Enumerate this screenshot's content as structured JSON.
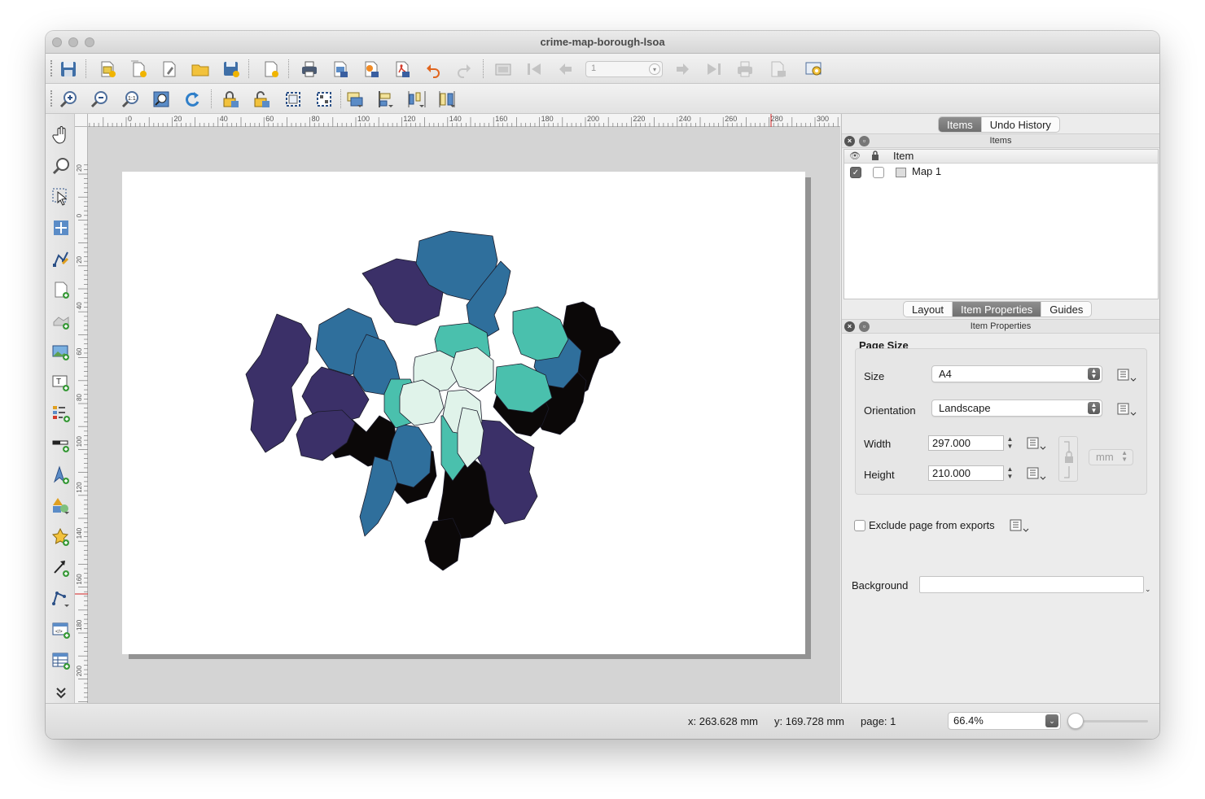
{
  "window": {
    "title": "crime-map-borough-lsoa"
  },
  "toolbar": {
    "page_number": "1",
    "icons_row1": [
      "save-icon",
      "new-layout-icon",
      "duplicate-layout-icon",
      "layout-manager-icon",
      "open-template-icon",
      "save-template-icon",
      "add-pages-icon",
      "print-icon",
      "export-image-icon",
      "export-svg-icon",
      "export-pdf-icon",
      "undo-icon",
      "redo-icon",
      "atlas-preview-icon",
      "first-feature-icon",
      "previous-feature-icon",
      "next-feature-icon",
      "last-feature-icon",
      "print-atlas-icon",
      "export-atlas-icon",
      "atlas-settings-icon"
    ],
    "icons_row2": [
      "zoom-in-icon",
      "zoom-out-icon",
      "zoom-100-icon",
      "zoom-full-icon",
      "refresh-icon",
      "lock-items-icon",
      "unlock-items-icon",
      "group-items-icon",
      "ungroup-items-icon",
      "raise-items-icon",
      "align-items-icon",
      "distribute-items-icon",
      "resize-items-icon"
    ]
  },
  "left_tools": [
    "pan-icon",
    "zoom-tool-icon",
    "select-move-icon",
    "move-content-icon",
    "edit-nodes-icon",
    "add-map-icon",
    "add-3d-map-icon",
    "add-picture-icon",
    "add-label-icon",
    "add-legend-icon",
    "add-scalebar-icon",
    "add-north-arrow-icon",
    "add-shape-icon",
    "add-marker-icon",
    "add-arrow-icon",
    "add-node-item-icon",
    "add-html-icon",
    "add-attribute-table-icon",
    "more-tools-icon"
  ],
  "ruler": {
    "h_labels": [
      "0",
      "20",
      "40",
      "60",
      "80",
      "100",
      "120",
      "140",
      "160",
      "180",
      "200",
      "220",
      "240",
      "260",
      "280",
      "300"
    ],
    "v_labels": [
      "20",
      "0",
      "20",
      "40",
      "60",
      "80",
      "100",
      "120",
      "140",
      "160",
      "180",
      "200",
      "220"
    ]
  },
  "map": {
    "colors": {
      "lightest": "#e0f3ea",
      "light_teal": "#4ac0ad",
      "blue": "#2f6f9c",
      "purple": "#3b3068",
      "black": "#0b0808"
    }
  },
  "items_panel": {
    "tabs": [
      "Items",
      "Undo History"
    ],
    "active_tab": "Items",
    "dock_title": "Items",
    "column_header": "Item",
    "rows": [
      {
        "label": "Map 1",
        "visible": true,
        "locked": false
      }
    ]
  },
  "properties_panel": {
    "tabs": [
      "Layout",
      "Item Properties",
      "Guides"
    ],
    "active_tab": "Item Properties",
    "dock_title": "Item Properties",
    "section_title": "Page Size",
    "size_label": "Size",
    "size_value": "A4",
    "orientation_label": "Orientation",
    "orientation_value": "Landscape",
    "width_label": "Width",
    "width_value": "297.000",
    "height_label": "Height",
    "height_value": "210.000",
    "unit": "mm",
    "exclude_label": "Exclude page from exports",
    "exclude_checked": false,
    "background_label": "Background"
  },
  "status": {
    "x": "x: 263.628 mm",
    "y": "y: 169.728 mm",
    "page": "page: 1",
    "zoom": "66.4%",
    "zoom_slider_fraction": 0.05
  }
}
